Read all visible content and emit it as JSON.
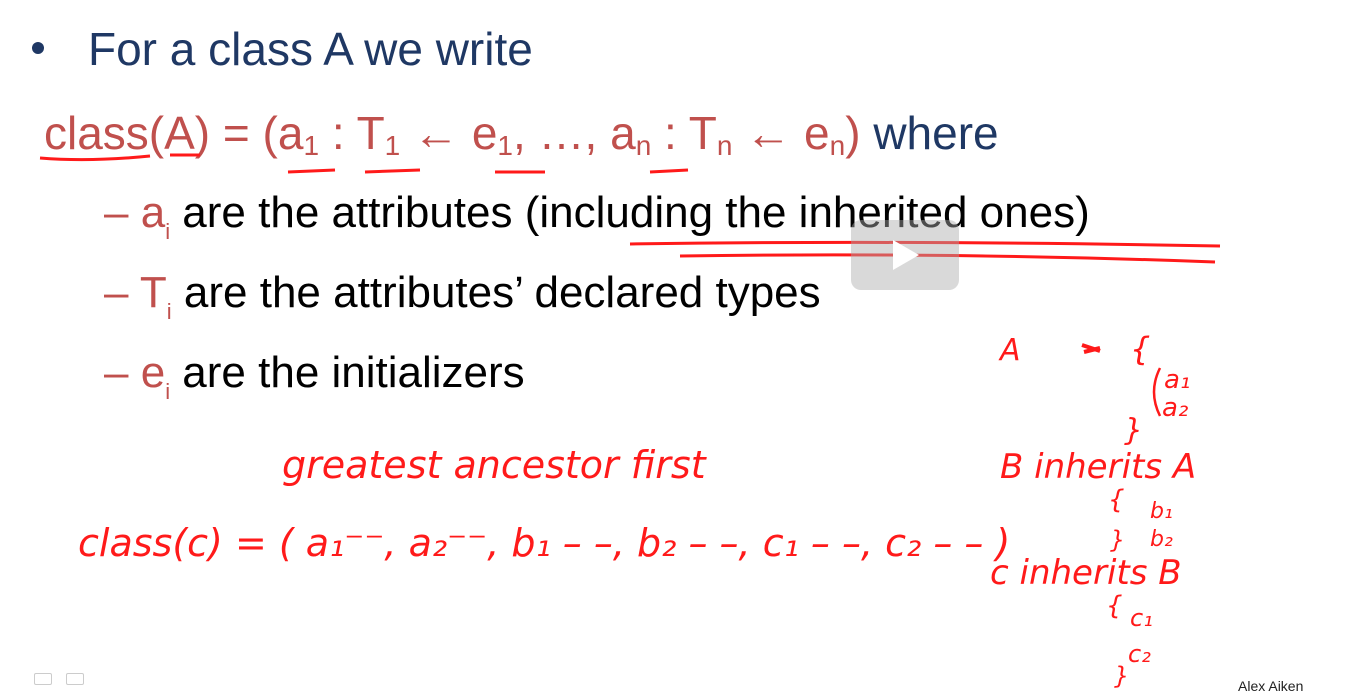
{
  "slide": {
    "bullet": "For a class A we write",
    "formula": {
      "class_a": "class(A)",
      "equals": " = (",
      "a": "a",
      "one": "1",
      "colon": " : ",
      "T": "T",
      "arrow": " ← ",
      "e": "e",
      "ellipsis": ", …, ",
      "n": "n",
      "close": ")",
      "where": " where"
    },
    "sub_items": [
      {
        "symbol": "a",
        "subscript": "i",
        "text": " are the attributes (including the inherited ones)"
      },
      {
        "symbol": "T",
        "subscript": "i",
        "text": " are the attributes’ declared types"
      },
      {
        "symbol": "e",
        "subscript": "i",
        "text": " are the initializers"
      }
    ],
    "dash": "– ",
    "author": "Alex Aiken"
  },
  "annotations": {
    "greatest_ancestor": "greatest ancestor first",
    "class_c": "class(c) = ( a₁⁻⁻, a₂⁻⁻, b₁ – –, b₂ – –, c₁ – –, c₂ – – )",
    "A": "A",
    "a1": "a₁",
    "a2": "a₂",
    "B_inherits_A": "B  inherits  A",
    "b1": "b₁",
    "b2": "b₂",
    "C_inherits_B": "c  inherits  B",
    "c1": "c₁",
    "c2": "c₂",
    "ink_color": "#ff1a1a"
  },
  "icons": [
    "bullet-dot-icon",
    "play-icon",
    "slide-menu-icon",
    "pen-icon"
  ],
  "colors": {
    "title": "#1f3864",
    "accent_red": "#c0504d",
    "ink": "#ff1a1a"
  }
}
